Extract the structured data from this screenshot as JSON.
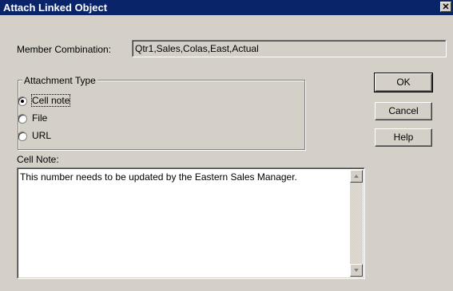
{
  "window": {
    "title": "Attach Linked Object",
    "close_glyph": "✕"
  },
  "member": {
    "label": "Member Combination:",
    "value": "Qtr1,Sales,Colas,East,Actual"
  },
  "attachment": {
    "title": "Attachment Type",
    "options": [
      {
        "label": "Cell note",
        "selected": true
      },
      {
        "label": "File",
        "selected": false
      },
      {
        "label": "URL",
        "selected": false
      }
    ]
  },
  "note": {
    "label": "Cell Note:",
    "text": "This number needs to be updated by the Eastern Sales Manager."
  },
  "buttons": {
    "ok": "OK",
    "cancel": "Cancel",
    "help": "Help"
  }
}
